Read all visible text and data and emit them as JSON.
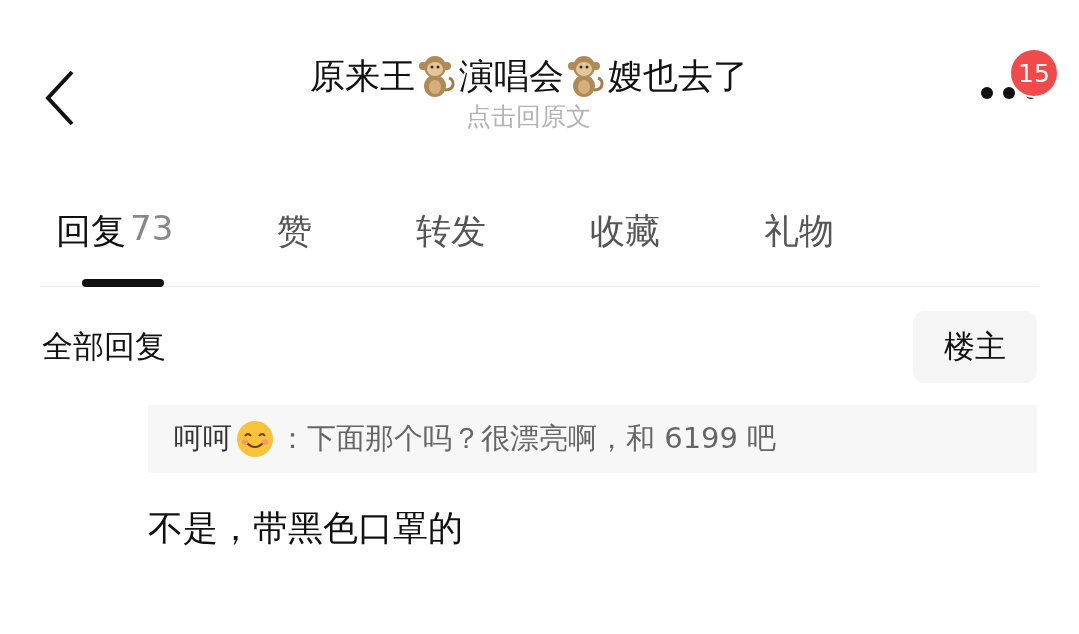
{
  "header": {
    "title_segments": [
      "原来王",
      "演唱会",
      "嫂也去了"
    ],
    "subtitle": "点击回原文",
    "badge": "15"
  },
  "tabs": [
    {
      "label": "回复",
      "count": "73",
      "selected": true
    },
    {
      "label": "赞",
      "selected": false
    },
    {
      "label": "转发",
      "selected": false
    },
    {
      "label": "收藏",
      "selected": false
    },
    {
      "label": "礼物",
      "selected": false
    }
  ],
  "section": {
    "title": "全部回复",
    "filter_button": "楼主"
  },
  "reply": {
    "quote_author": "呵呵",
    "quote_text": "：下面那个吗？很漂亮啊，和 6199 吧",
    "text": "不是，带黑色口罩的"
  }
}
